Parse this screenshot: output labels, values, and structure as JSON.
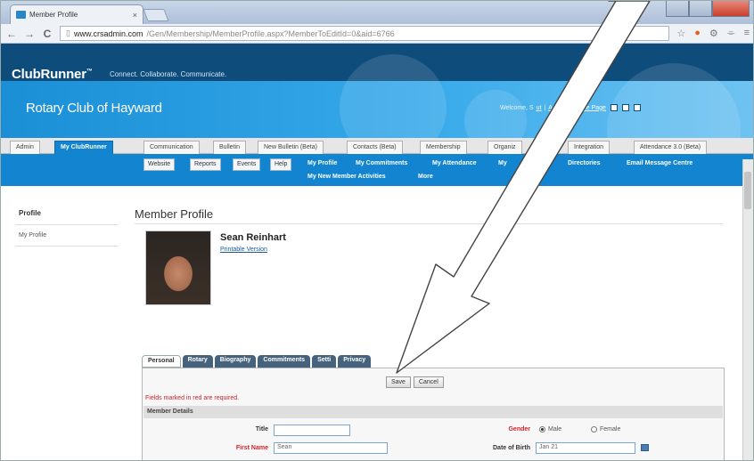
{
  "browser": {
    "tab_title": "Member Profile",
    "tab_close": "×",
    "url_host": "www.crsadmin.com",
    "url_path": "/Gen/Membership/MemberProfile.aspx?MemberToEditId=0&aid=6766",
    "nav_back": "←",
    "nav_forward": "→",
    "nav_reload": "C",
    "icons": [
      "star-icon",
      "extension-icon",
      "settings-icon",
      "menu-icon"
    ]
  },
  "brand": {
    "logo": "ClubRunner",
    "trademark": "™",
    "tagline": "Connect. Collaborate. Communicate."
  },
  "club": {
    "name": "Rotary Club of Hayward"
  },
  "header_links": {
    "welcome": "Welcome, S",
    "logout": "ut",
    "admin": "Admin",
    "home": "Home Page",
    "sep": "|"
  },
  "main_tabs": [
    "Admin",
    "My ClubRunner",
    "Communication",
    "Bulletin",
    "New Bulletin (Beta)",
    "Contacts (Beta)",
    "Membership",
    "Organiz",
    "Integration",
    "Attendance 3.0 (Beta)"
  ],
  "sub_buttons": [
    "Website",
    "Reports",
    "Events",
    "Help"
  ],
  "sub_links": [
    "My Profile",
    "My Commitments",
    "My Attendance",
    "My",
    "ess",
    "Directories",
    "Email Message Centre"
  ],
  "sub_links_row2": [
    "My New Member Activities",
    "More"
  ],
  "sidebar": {
    "heading": "Profile",
    "items": [
      "My Profile"
    ]
  },
  "page": {
    "title": "Member Profile"
  },
  "member": {
    "name": "Sean Reinhart",
    "printable": "Printable Version"
  },
  "profile_tabs": [
    "Personal",
    "Rotary",
    "Biography",
    "Commitments",
    "Setti",
    "Privacy"
  ],
  "form": {
    "save": "Save",
    "cancel": "Cancel",
    "required_note": "Fields marked in red are required.",
    "section": "Member Details",
    "title_label": "Title",
    "title_value": "",
    "first_name_label": "First Name",
    "first_name_value": "Sean",
    "gender_label": "Gender",
    "gender_options": [
      "Male",
      "Female"
    ],
    "gender_selected": "Male",
    "dob_label": "Date of Birth",
    "dob_value": "Jan 21"
  },
  "colors": {
    "brand_dark": "#0e4c7c",
    "brand_blue": "#1384cf",
    "required_red": "#d0202a"
  }
}
